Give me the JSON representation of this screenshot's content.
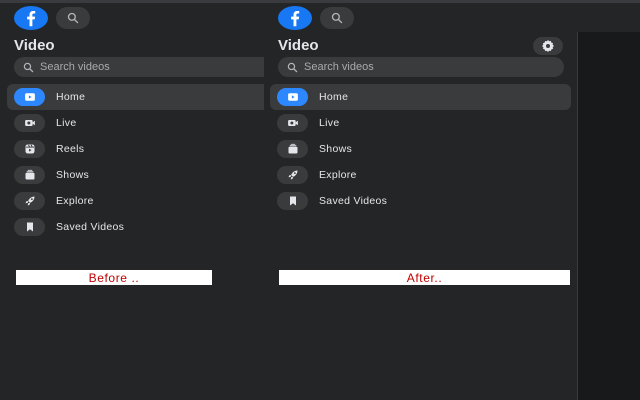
{
  "left": {
    "title": "Video",
    "search_placeholder": "Search videos",
    "items": [
      {
        "label": "Home",
        "icon": "video-play-icon",
        "active": true
      },
      {
        "label": "Live",
        "icon": "live-camera-icon"
      },
      {
        "label": "Reels",
        "icon": "reels-icon"
      },
      {
        "label": "Shows",
        "icon": "shows-icon"
      },
      {
        "label": "Explore",
        "icon": "rocket-icon"
      },
      {
        "label": "Saved Videos",
        "icon": "bookmark-icon"
      }
    ],
    "caption": "Before .."
  },
  "right": {
    "title": "Video",
    "search_placeholder": "Search videos",
    "items": [
      {
        "label": "Home",
        "icon": "video-play-icon",
        "active": true
      },
      {
        "label": "Live",
        "icon": "live-camera-icon"
      },
      {
        "label": "Shows",
        "icon": "shows-icon"
      },
      {
        "label": "Explore",
        "icon": "rocket-icon"
      },
      {
        "label": "Saved Videos",
        "icon": "bookmark-icon"
      }
    ],
    "caption": "After.."
  },
  "colors": {
    "brand": "#1877f2",
    "active_icon": "#2d88ff",
    "caption_text": "#c00000",
    "panel_bg": "#242526"
  }
}
